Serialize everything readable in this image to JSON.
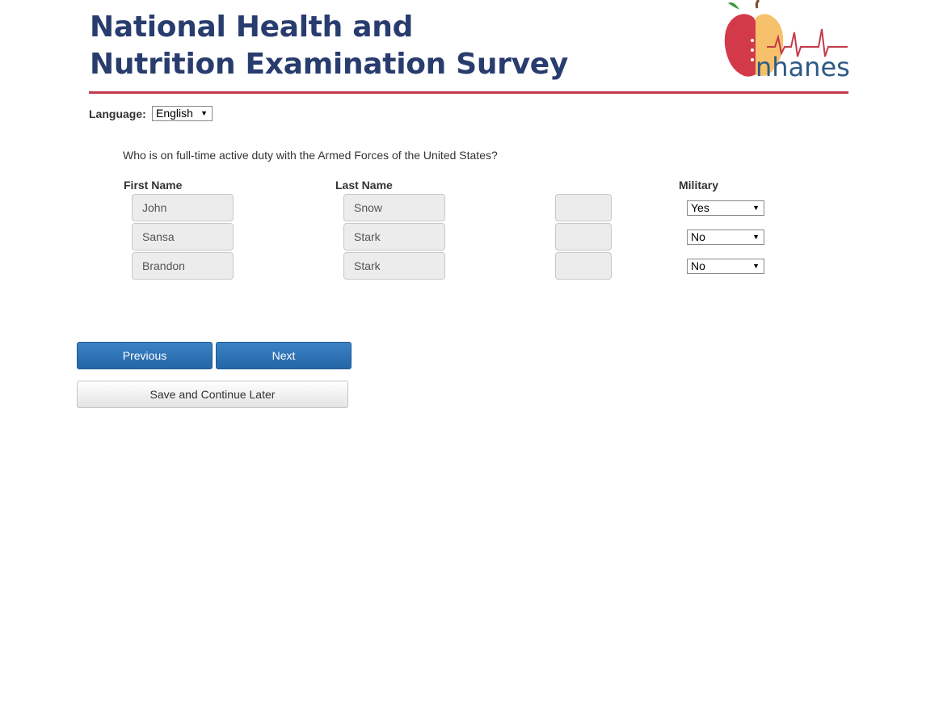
{
  "header": {
    "title_line1": "National Health and",
    "title_line2": "Nutrition Examination Survey",
    "logo_text": "nhanes",
    "logo_icon": "apple-heartbeat-logo-icon",
    "rule_color": "#c33b4b"
  },
  "language": {
    "label": "Language:",
    "selected": "English"
  },
  "question": "Who is on full-time active duty with the Armed Forces of the United States?",
  "columns": {
    "first_name": "First Name",
    "last_name": "Last Name",
    "military": "Military"
  },
  "rows": [
    {
      "first": "John",
      "last": "Snow",
      "extra": "",
      "military": "Yes"
    },
    {
      "first": "Sansa",
      "last": "Stark",
      "extra": "",
      "military": "No"
    },
    {
      "first": "Brandon",
      "last": "Stark",
      "extra": "",
      "military": "No"
    }
  ],
  "buttons": {
    "previous": "Previous",
    "next": "Next",
    "save": "Save and Continue Later"
  },
  "colors": {
    "title": "#283c6e",
    "primary_button": "#2d74b8",
    "field_bg": "#ececec"
  }
}
